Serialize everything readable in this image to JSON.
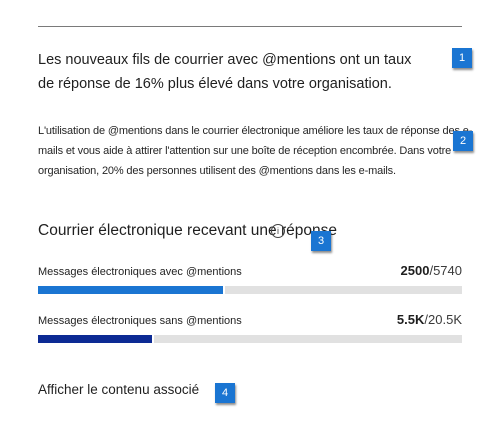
{
  "headline": "Les nouveaux fils de courrier avec @mentions ont un taux de réponse de 16% plus élevé dans votre organisation.",
  "body": "L'utilisation de @mentions dans le courrier électronique améliore les taux de réponse des e-mails et vous aide à attirer l'attention sur une boîte de réception encombrée. Dans votre organisation, 20% des personnes utilisent des @mentions dans les e-mails.",
  "section": {
    "title": "Courrier électronique recevant une réponse",
    "info_glyph": "i"
  },
  "metrics": [
    {
      "label": "Messages électroniques avec @mentions",
      "value": "2500",
      "total": "5740",
      "fraction": 0.4355,
      "color": "#1a75d2"
    },
    {
      "label": "Messages électroniques sans @mentions",
      "value": "5.5K",
      "total": "20.5K",
      "fraction": 0.2683,
      "color": "#0c2a94"
    }
  ],
  "separator": "/",
  "link": "Afficher le contenu associé",
  "callouts": [
    "1",
    "2",
    "3",
    "4"
  ],
  "colors": {
    "callout": "#1a75d2",
    "track": "#e1e1e1"
  }
}
